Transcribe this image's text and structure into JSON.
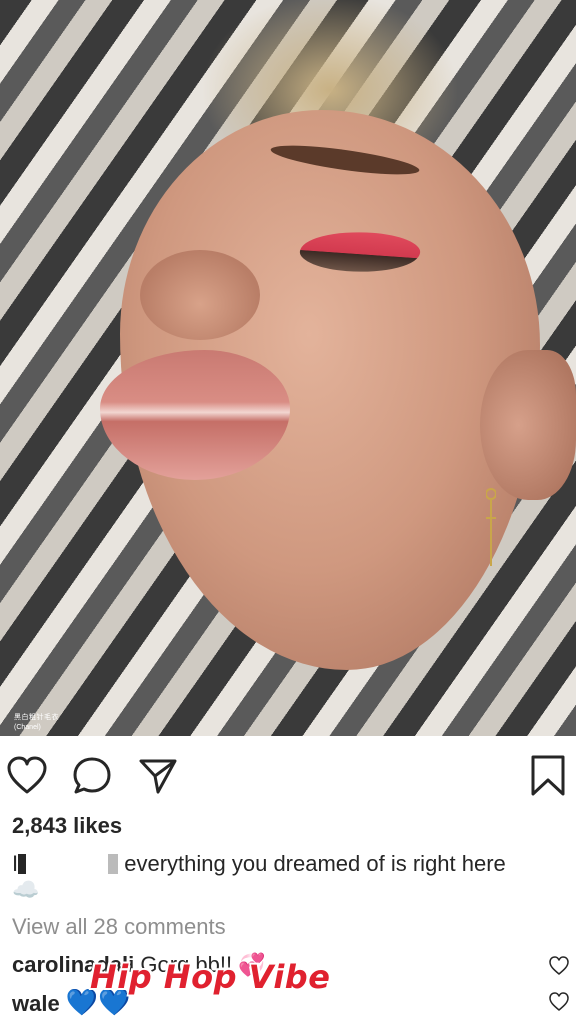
{
  "photo": {
    "caption_chinese": "黑白粗针毛衣",
    "caption_brand": "(Chanel)"
  },
  "post": {
    "likes": "2,843 likes",
    "caption_user_prefix": "I",
    "caption_text": "everything you dreamed of is right here",
    "caption_emoji": "☁️",
    "view_all_comments": "View all 28 comments"
  },
  "comments": [
    {
      "user": "carolinadali",
      "text": "Gorg bb!!",
      "emoji": "💞"
    },
    {
      "user": "wale",
      "text": "",
      "emoji": "💙💙"
    }
  ],
  "watermark": "Hip Hop Vibe",
  "colors": {
    "text": "#262626",
    "muted": "#8e8e8e",
    "watermark": "#e0212f"
  }
}
